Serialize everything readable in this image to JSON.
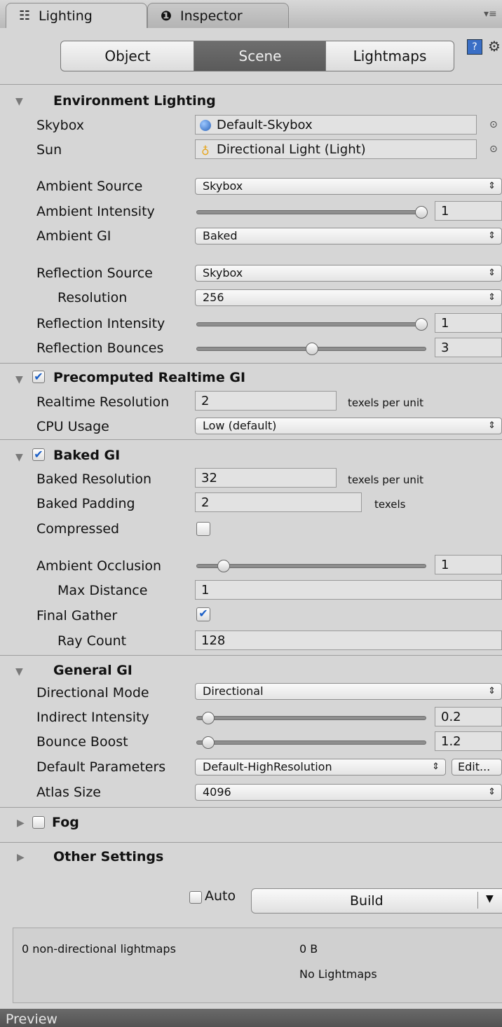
{
  "tabs": {
    "lighting": "Lighting",
    "inspector": "Inspector"
  },
  "toolbar": {
    "object": "Object",
    "scene": "Scene",
    "lightmaps": "Lightmaps"
  },
  "environment": {
    "header": "Environment Lighting",
    "skybox_label": "Skybox",
    "skybox_value": "Default-Skybox",
    "sun_label": "Sun",
    "sun_value": "Directional Light (Light)",
    "ambient_source_label": "Ambient Source",
    "ambient_source_value": "Skybox",
    "ambient_intensity_label": "Ambient Intensity",
    "ambient_intensity_value": "1",
    "ambient_gi_label": "Ambient GI",
    "ambient_gi_value": "Baked",
    "reflection_source_label": "Reflection Source",
    "reflection_source_value": "Skybox",
    "resolution_label": "Resolution",
    "resolution_value": "256",
    "reflection_intensity_label": "Reflection Intensity",
    "reflection_intensity_value": "1",
    "reflection_bounces_label": "Reflection Bounces",
    "reflection_bounces_value": "3"
  },
  "realtime_gi": {
    "header": "Precomputed Realtime GI",
    "resolution_label": "Realtime Resolution",
    "resolution_value": "2",
    "resolution_unit": "texels per unit",
    "cpu_label": "CPU Usage",
    "cpu_value": "Low (default)"
  },
  "baked_gi": {
    "header": "Baked GI",
    "resolution_label": "Baked Resolution",
    "resolution_value": "32",
    "resolution_unit": "texels per unit",
    "padding_label": "Baked Padding",
    "padding_value": "2",
    "padding_unit": "texels",
    "compressed_label": "Compressed",
    "ao_label": "Ambient Occlusion",
    "ao_value": "1",
    "max_distance_label": "Max Distance",
    "max_distance_value": "1",
    "final_gather_label": "Final Gather",
    "ray_count_label": "Ray Count",
    "ray_count_value": "128"
  },
  "general_gi": {
    "header": "General GI",
    "directional_mode_label": "Directional Mode",
    "directional_mode_value": "Directional",
    "indirect_intensity_label": "Indirect Intensity",
    "indirect_intensity_value": "0.2",
    "bounce_boost_label": "Bounce Boost",
    "bounce_boost_value": "1.2",
    "default_params_label": "Default Parameters",
    "default_params_value": "Default-HighResolution",
    "edit_label": "Edit...",
    "atlas_size_label": "Atlas Size",
    "atlas_size_value": "4096"
  },
  "fog": {
    "header": "Fog"
  },
  "other": {
    "header": "Other Settings"
  },
  "build": {
    "auto_label": "Auto",
    "build_label": "Build"
  },
  "footer": {
    "lightmaps_count": "0 non-directional lightmaps",
    "size": "0 B",
    "status": "No Lightmaps"
  },
  "preview": "Preview"
}
